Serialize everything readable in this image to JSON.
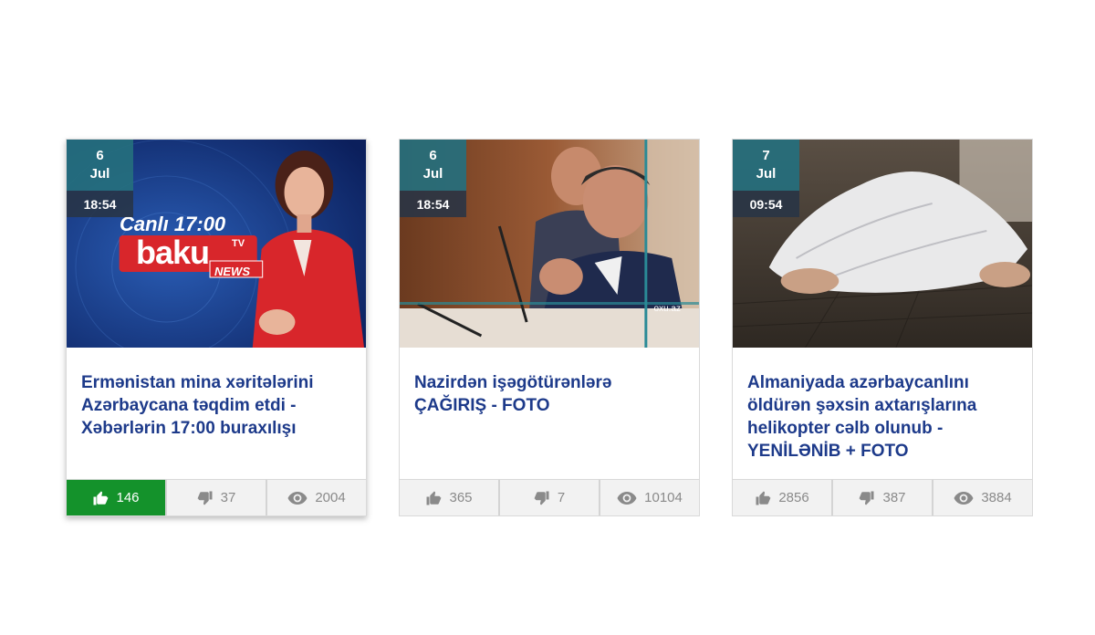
{
  "cards": [
    {
      "day": "6",
      "month": "Jul",
      "time": "18:54",
      "title": "Ermənistan mina xəritələrini Azərbaycana təqdim etdi - Xəbərlərin 17:00 buraxılışı",
      "likes": "146",
      "dislikes": "37",
      "views": "2004",
      "liked": true,
      "image_text": {
        "live": "Canlı 17:00",
        "brand": "baku",
        "tv": "TV",
        "news": "NEWS"
      }
    },
    {
      "day": "6",
      "month": "Jul",
      "time": "18:54",
      "title": "Nazirdən işəgötürənlərə ÇAĞIRIŞ - FOTO",
      "likes": "365",
      "dislikes": "7",
      "views": "10104",
      "liked": false,
      "image_text": {
        "watermark": "oxu.az"
      }
    },
    {
      "day": "7",
      "month": "Jul",
      "time": "09:54",
      "title": "Almaniyada azərbaycanlını öldürən şəxsin axtarışlarına helikopter cəlb olunub - YENİLƏNİB + FOTO",
      "likes": "2856",
      "dislikes": "387",
      "views": "3884",
      "liked": false
    }
  ],
  "icons": {
    "like": "thumbs-up-icon",
    "dislike": "thumbs-down-icon",
    "views": "eye-icon"
  },
  "colors": {
    "title": "#1d3a8a",
    "liked_bg": "#14922b",
    "date_bg": "#256f7d",
    "time_bg": "#283446"
  }
}
